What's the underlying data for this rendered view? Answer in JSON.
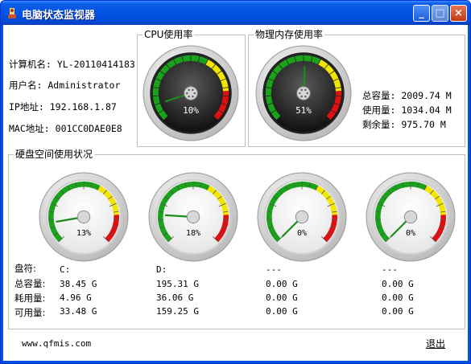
{
  "window": {
    "title": "电脑状态监视器"
  },
  "computer": {
    "name_label": "计算机名:",
    "name_value": "YL-20110414183",
    "user_label": "用户名:",
    "user_value": "Administrator",
    "ip_label": "IP地址:",
    "ip_value": "192.168.1.87",
    "mac_label": "MAC地址:",
    "mac_value": "001CC0DAE0E8"
  },
  "cpu": {
    "title": "CPU使用率",
    "percent": 10,
    "percent_text": "10%"
  },
  "memory": {
    "title": "物理内存使用率",
    "percent": 51,
    "percent_text": "51%",
    "total_label": "总容量:",
    "total_value": "2009.74 M",
    "used_label": "使用量:",
    "used_value": "1034.04 M",
    "free_label": "剩余量:",
    "free_value": "975.70 M"
  },
  "disk": {
    "title": "硬盘空间使用状况",
    "row_labels": {
      "drive": "盘符:",
      "total": "总容量:",
      "used": "耗用量:",
      "free": "可用量:"
    },
    "drives": [
      {
        "letter": "C:",
        "percent": 13,
        "percent_text": "13%",
        "total": "38.45 G",
        "used": "4.96 G",
        "free": "33.48 G"
      },
      {
        "letter": "D:",
        "percent": 18,
        "percent_text": "18%",
        "total": "195.31 G",
        "used": "36.06 G",
        "free": "159.25 G"
      },
      {
        "letter": "---",
        "percent": 0,
        "percent_text": "0%",
        "total": "0.00 G",
        "used": "0.00 G",
        "free": "0.00 G"
      },
      {
        "letter": "---",
        "percent": 0,
        "percent_text": "0%",
        "total": "0.00 G",
        "used": "0.00 G",
        "free": "0.00 G"
      }
    ]
  },
  "footer": {
    "website": "www.qfmis.com",
    "exit_label": "退出"
  }
}
